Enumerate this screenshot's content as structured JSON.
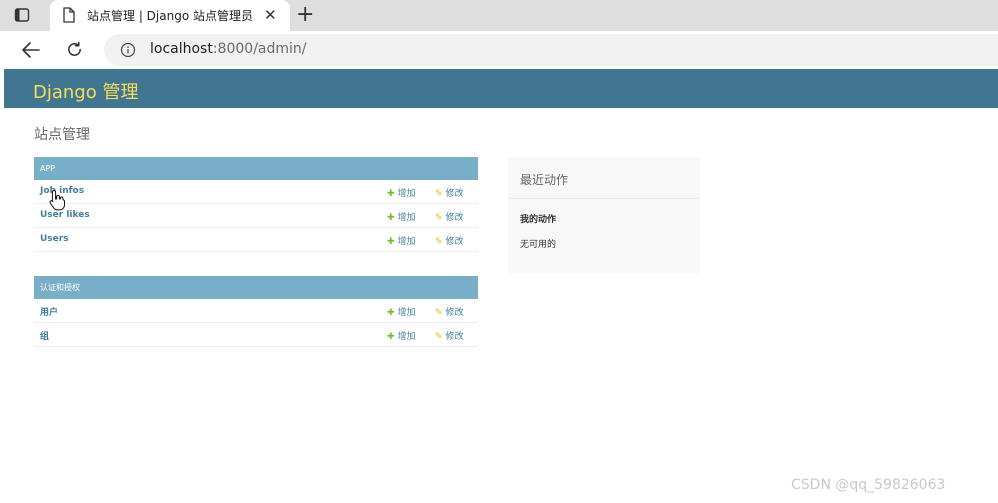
{
  "browser": {
    "tab_title": "站点管理 | Django 站点管理员",
    "close_glyph": "✕",
    "new_tab_glyph": "+",
    "url_host": "localhost",
    "url_rest": ":8000/admin/"
  },
  "header": {
    "brand": "Django 管理"
  },
  "page": {
    "title": "站点管理"
  },
  "modules": [
    {
      "caption": "APP",
      "rows": [
        {
          "name": "Job infos",
          "add": "增加",
          "change": "修改"
        },
        {
          "name": "User likes",
          "add": "增加",
          "change": "修改"
        },
        {
          "name": "Users",
          "add": "增加",
          "change": "修改"
        }
      ]
    },
    {
      "caption": "认证和授权",
      "rows": [
        {
          "name": "用户",
          "add": "增加",
          "change": "修改"
        },
        {
          "name": "组",
          "add": "增加",
          "change": "修改"
        }
      ]
    }
  ],
  "recent_actions": {
    "title": "最近动作",
    "my_actions": "我的动作",
    "none": "无可用的"
  },
  "watermark": "CSDN @qq_59826063",
  "colors": {
    "header_bg": "#417690",
    "brand": "#f5dd5d",
    "caption_bg": "#79aec8",
    "link": "#447e9b",
    "add_plus": "#70bf2b",
    "change_pencil": "#efb80b"
  },
  "icons": {
    "tab_layout": "tab-layout-icon",
    "tab_page": "document-icon",
    "back": "arrow-left-icon",
    "refresh": "refresh-icon",
    "site_info": "info-icon",
    "add": "plus-icon",
    "change": "pencil-icon",
    "cursor": "hand-cursor-icon"
  }
}
